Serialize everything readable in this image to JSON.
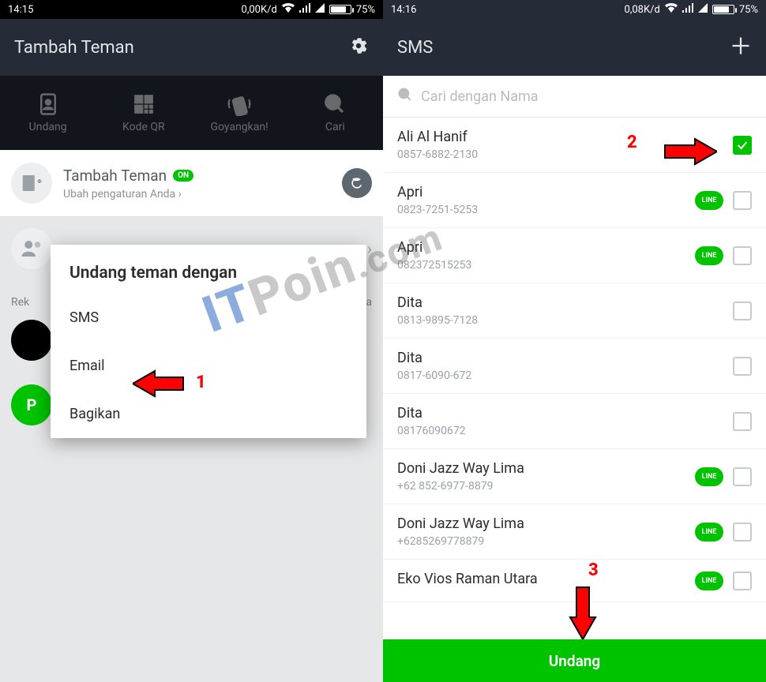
{
  "left": {
    "status": {
      "time": "14:15",
      "speed": "0,00K/d",
      "battery": "75%"
    },
    "header": {
      "title": "Tambah Teman"
    },
    "tabs": [
      {
        "label": "Undang"
      },
      {
        "label": "Kode QR"
      },
      {
        "label": "Goyangkan!"
      },
      {
        "label": "Cari"
      }
    ],
    "card": {
      "title": "Tambah Teman",
      "badge": "ON",
      "subtitle": "Ubah pengaturan Anda  ›"
    },
    "rek_left": "Rek",
    "rek_right": "ua",
    "avatar_green_letter": "P",
    "modal": {
      "title": "Undang teman dengan",
      "options": [
        "SMS",
        "Email",
        "Bagikan"
      ]
    }
  },
  "right": {
    "status": {
      "time": "14:16",
      "speed": "0,08K/d",
      "battery": "75%"
    },
    "header": {
      "title": "SMS"
    },
    "search_placeholder": "Cari dengan Nama",
    "line_badge_label": "LINE",
    "contacts": [
      {
        "name": "Ali Al Hanif",
        "number": "0857-6882-2130",
        "has_line": false,
        "checked": true
      },
      {
        "name": "Apri",
        "number": "0823-7251-5253",
        "has_line": true,
        "checked": false
      },
      {
        "name": "Apri",
        "number": "082372515253",
        "has_line": true,
        "checked": false
      },
      {
        "name": "Dita",
        "number": "0813-9895-7128",
        "has_line": false,
        "checked": false
      },
      {
        "name": "Dita",
        "number": "0817-6090-672",
        "has_line": false,
        "checked": false
      },
      {
        "name": "Dita",
        "number": "08176090672",
        "has_line": false,
        "checked": false
      },
      {
        "name": "Doni Jazz Way Lima",
        "number": "+62 852-6977-8879",
        "has_line": true,
        "checked": false
      },
      {
        "name": "Doni Jazz Way Lima",
        "number": "+6285269778879",
        "has_line": true,
        "checked": false
      },
      {
        "name": "Eko Vios Raman Utara",
        "number": "",
        "has_line": true,
        "checked": false
      }
    ],
    "button": "Undang"
  },
  "annotations": {
    "n1": "1",
    "n2": "2",
    "n3": "3"
  },
  "watermark": "ITPoin.com"
}
